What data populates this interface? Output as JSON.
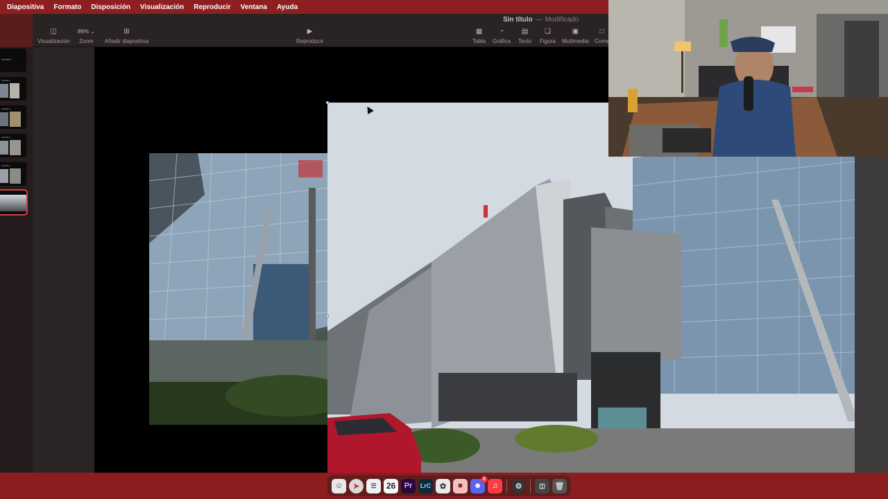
{
  "menubar": {
    "items": [
      "Diapositiva",
      "Formato",
      "Disposición",
      "Visualización",
      "Reproducir",
      "Ventana",
      "Ayuda"
    ]
  },
  "toolbar": {
    "title": "Sin título",
    "separator": "—",
    "status": "Modificado",
    "view_label": "Visualización",
    "zoom_value": "86%",
    "zoom_label": "Zoom",
    "add_slide_label": "Añadir diapositiva",
    "play_label": "Reproducir",
    "table_label": "Tabla",
    "chart_label": "Gráfica",
    "text_label": "Texto",
    "shape_label": "Figura",
    "media_label": "Multimedia",
    "comment_label": "Come"
  },
  "navigator": {
    "slides": [
      {
        "title": "COUTING",
        "selected": false
      },
      {
        "title": "Lección 1",
        "selected": false
      },
      {
        "title": "Lección 2",
        "selected": false
      },
      {
        "title": "Lección 3",
        "selected": false
      },
      {
        "title": "Lección 4",
        "selected": false
      },
      {
        "title": "",
        "selected": true
      }
    ]
  },
  "dock": {
    "calendar_day": "26",
    "premiere_label": "Pr",
    "lrc_label": "LrC",
    "badge_count": "2"
  },
  "colors": {
    "menubar": "#8e1f21",
    "accent": "#d23c3c"
  }
}
